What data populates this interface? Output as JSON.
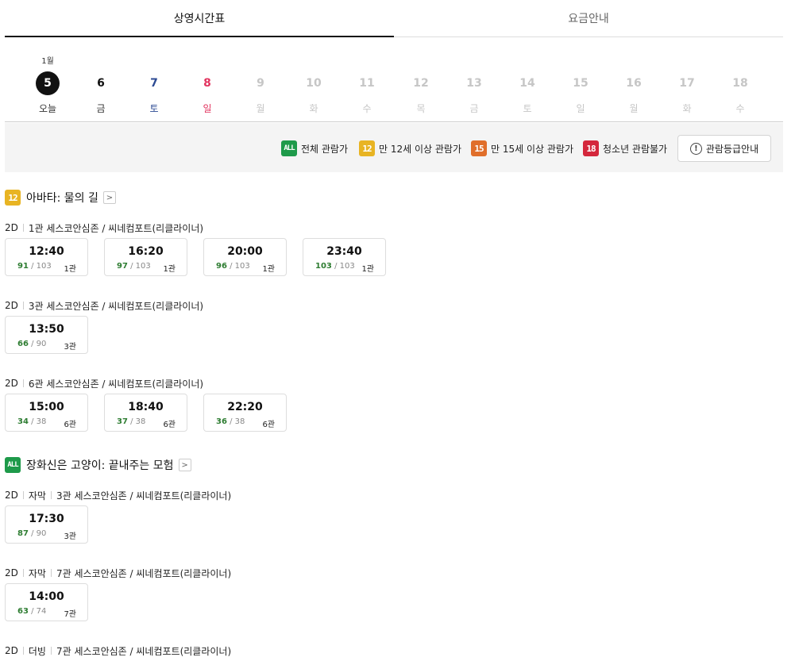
{
  "tabs": [
    {
      "label": "상영시간표",
      "active": true
    },
    {
      "label": "요금안내",
      "active": false
    }
  ],
  "dates": [
    {
      "month": "1월",
      "day": "5",
      "dow": "오늘",
      "day_color": "today",
      "dow_color": "black"
    },
    {
      "month": "",
      "day": "6",
      "dow": "금",
      "day_color": "black",
      "dow_color": "black"
    },
    {
      "month": "",
      "day": "7",
      "dow": "토",
      "day_color": "blue",
      "dow_color": "blue"
    },
    {
      "month": "",
      "day": "8",
      "dow": "일",
      "day_color": "red",
      "dow_color": "red"
    },
    {
      "month": "",
      "day": "9",
      "dow": "월",
      "day_color": "gray",
      "dow_color": "gray"
    },
    {
      "month": "",
      "day": "10",
      "dow": "화",
      "day_color": "gray",
      "dow_color": "gray"
    },
    {
      "month": "",
      "day": "11",
      "dow": "수",
      "day_color": "gray",
      "dow_color": "gray"
    },
    {
      "month": "",
      "day": "12",
      "dow": "목",
      "day_color": "gray",
      "dow_color": "gray"
    },
    {
      "month": "",
      "day": "13",
      "dow": "금",
      "day_color": "gray",
      "dow_color": "gray"
    },
    {
      "month": "",
      "day": "14",
      "dow": "토",
      "day_color": "gray",
      "dow_color": "gray"
    },
    {
      "month": "",
      "day": "15",
      "dow": "일",
      "day_color": "gray",
      "dow_color": "gray"
    },
    {
      "month": "",
      "day": "16",
      "dow": "월",
      "day_color": "gray",
      "dow_color": "gray"
    },
    {
      "month": "",
      "day": "17",
      "dow": "화",
      "day_color": "gray",
      "dow_color": "gray"
    },
    {
      "month": "",
      "day": "18",
      "dow": "수",
      "day_color": "gray",
      "dow_color": "gray"
    }
  ],
  "ratings": {
    "all": {
      "badge": "ALL",
      "label": "전체 관람가"
    },
    "r12": {
      "badge": "12",
      "label": "만 12세 이상 관람가"
    },
    "r15": {
      "badge": "15",
      "label": "만 15세 이상 관람가"
    },
    "r18": {
      "badge": "18",
      "label": "청소년 관람불가"
    },
    "guide_label": "관람등급안내",
    "guide_icon": "!"
  },
  "colors": {
    "all": "#1e9a4a",
    "r12": "#e8b423",
    "r15": "#e06e2a",
    "r18": "#d4273c",
    "remaining_seats": "#2e7d32",
    "saturday": "#2c4a93",
    "sunday": "#e2345f"
  },
  "movies": [
    {
      "title": "아바타: 물의 길",
      "rating": "12",
      "chevron": ">",
      "groups": [
        {
          "format": "2D",
          "sub": "",
          "hall": "1관 세스코안심존 / 씨네컴포트(리클라이너)",
          "slots": [
            {
              "time": "12:40",
              "remain": "91",
              "total": "/ 103",
              "room": "1관"
            },
            {
              "time": "16:20",
              "remain": "97",
              "total": "/ 103",
              "room": "1관"
            },
            {
              "time": "20:00",
              "remain": "96",
              "total": "/ 103",
              "room": "1관"
            },
            {
              "time": "23:40",
              "remain": "103",
              "total": "/ 103",
              "room": "1관"
            }
          ]
        },
        {
          "format": "2D",
          "sub": "",
          "hall": "3관 세스코안심존 / 씨네컴포트(리클라이너)",
          "slots": [
            {
              "time": "13:50",
              "remain": "66",
              "total": "/ 90",
              "room": "3관"
            }
          ]
        },
        {
          "format": "2D",
          "sub": "",
          "hall": "6관 세스코안심존 / 씨네컴포트(리클라이너)",
          "slots": [
            {
              "time": "15:00",
              "remain": "34",
              "total": "/ 38",
              "room": "6관"
            },
            {
              "time": "18:40",
              "remain": "37",
              "total": "/ 38",
              "room": "6관"
            },
            {
              "time": "22:20",
              "remain": "36",
              "total": "/ 38",
              "room": "6관"
            }
          ]
        }
      ]
    },
    {
      "title": "장화신은 고양이: 끝내주는 모험",
      "rating": "ALL",
      "chevron": ">",
      "groups": [
        {
          "format": "2D",
          "sub": "자막",
          "hall": "3관 세스코안심존 / 씨네컴포트(리클라이너)",
          "slots": [
            {
              "time": "17:30",
              "remain": "87",
              "total": "/ 90",
              "room": "3관"
            }
          ]
        },
        {
          "format": "2D",
          "sub": "자막",
          "hall": "7관 세스코안심존 / 씨네컴포트(리클라이너)",
          "slots": [
            {
              "time": "14:00",
              "remain": "63",
              "total": "/ 74",
              "room": "7관"
            }
          ]
        },
        {
          "format": "2D",
          "sub": "더빙",
          "hall": "7관 세스코안심존 / 씨네컴포트(리클라이너)",
          "slots": []
        }
      ]
    }
  ]
}
